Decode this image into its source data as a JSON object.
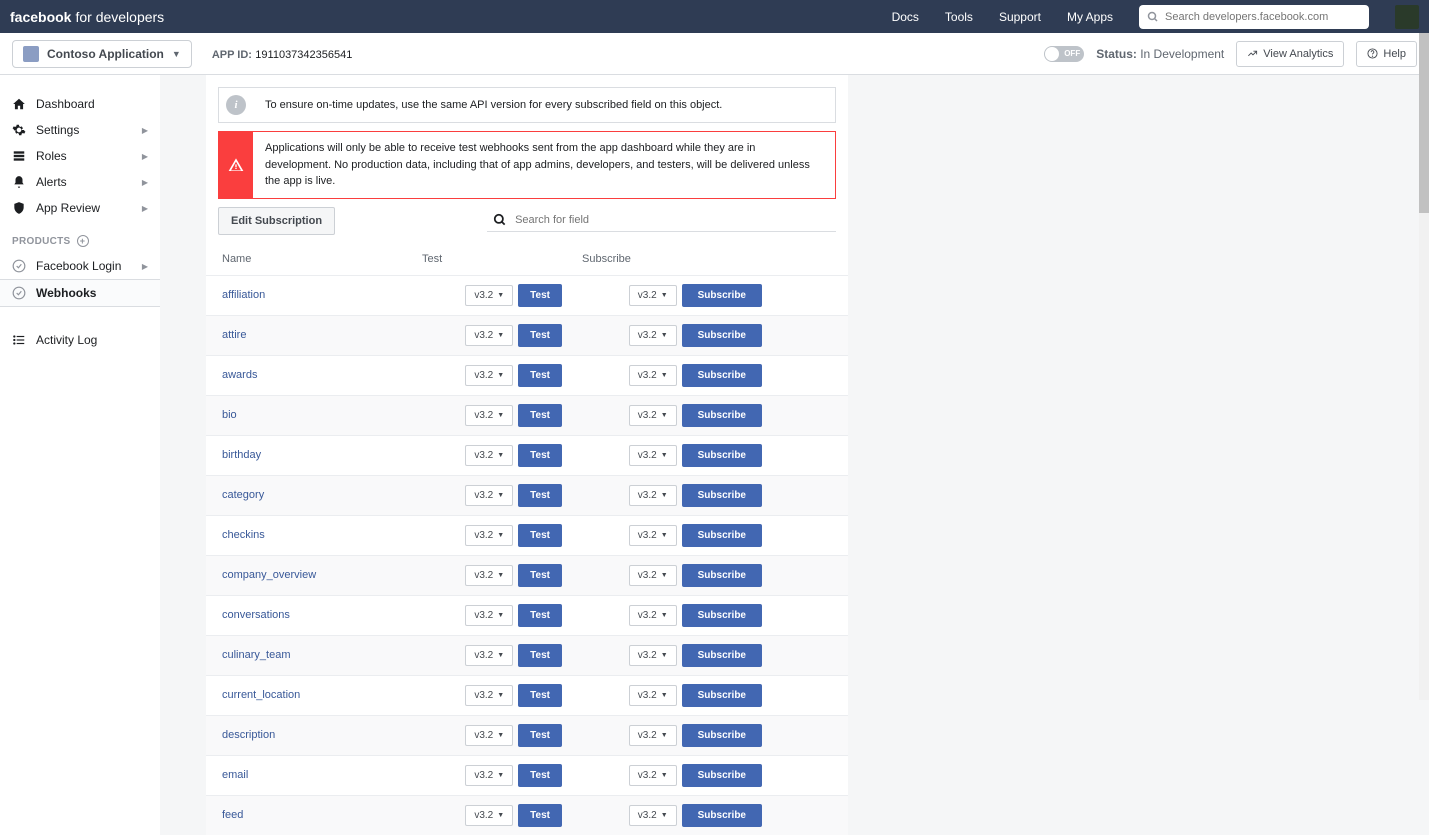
{
  "topbar": {
    "brand_bold": "facebook",
    "brand_light": "for developers",
    "links": [
      "Docs",
      "Tools",
      "Support",
      "My Apps"
    ],
    "search_placeholder": "Search developers.facebook.com"
  },
  "subbar": {
    "app_name": "Contoso Application",
    "app_id_label": "APP ID:",
    "app_id_value": "1911037342356541",
    "toggle": "OFF",
    "status_label": "Status:",
    "status_value": "In Development",
    "view_analytics": "View Analytics",
    "help": "Help"
  },
  "sidebar": {
    "items": [
      {
        "label": "Dashboard",
        "icon": "home",
        "chev": false
      },
      {
        "label": "Settings",
        "icon": "gear",
        "chev": true
      },
      {
        "label": "Roles",
        "icon": "roles",
        "chev": true
      },
      {
        "label": "Alerts",
        "icon": "bell",
        "chev": true
      },
      {
        "label": "App Review",
        "icon": "shield",
        "chev": true
      }
    ],
    "products_label": "PRODUCTS",
    "products": [
      {
        "label": "Facebook Login",
        "chev": true,
        "active": false
      },
      {
        "label": "Webhooks",
        "chev": false,
        "active": true
      }
    ],
    "activity_log": "Activity Log"
  },
  "alerts": {
    "info": "To ensure on-time updates, use the same API version for every subscribed field on this object.",
    "warn": "Applications will only be able to receive test webhooks sent from the app dashboard while they are in development. No production data, including that of app admins, developers, and testers, will be delivered unless the app is live."
  },
  "toolbar": {
    "edit_label": "Edit Subscription",
    "search_placeholder": "Search for field"
  },
  "table": {
    "head_name": "Name",
    "head_test": "Test",
    "head_sub": "Subscribe",
    "version": "v3.2",
    "test_btn": "Test",
    "sub_btn": "Subscribe",
    "fields": [
      "affiliation",
      "attire",
      "awards",
      "bio",
      "birthday",
      "category",
      "checkins",
      "company_overview",
      "conversations",
      "culinary_team",
      "current_location",
      "description",
      "email",
      "feed"
    ]
  }
}
